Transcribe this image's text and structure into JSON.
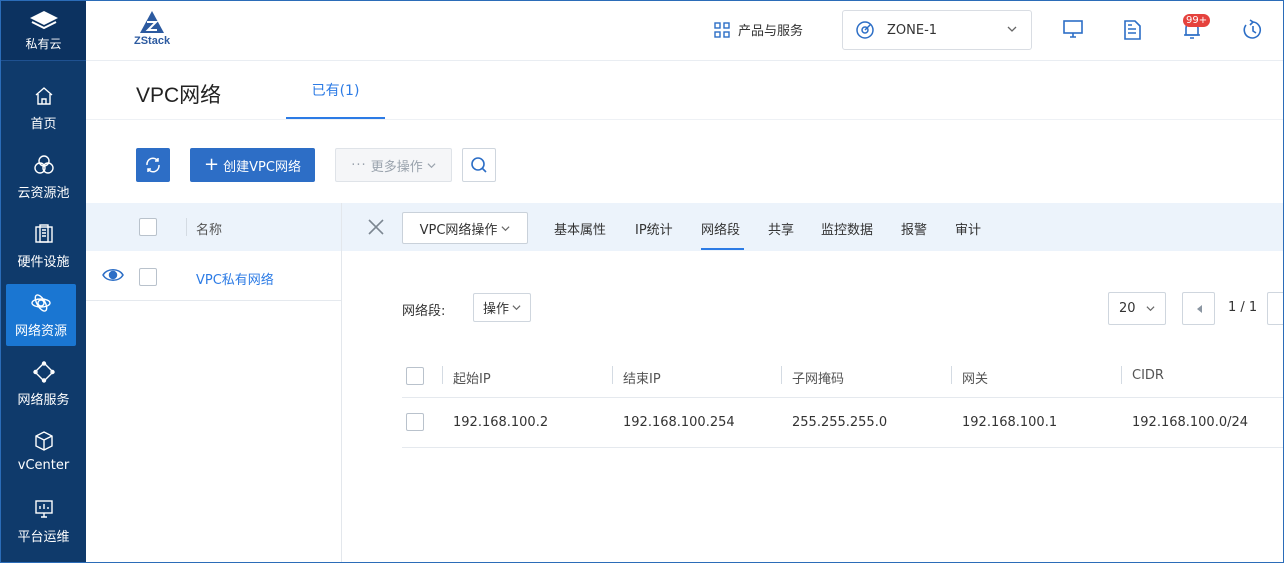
{
  "sidebar": {
    "brand_label": "私有云",
    "items": [
      {
        "label": "首页",
        "icon": "home-icon"
      },
      {
        "label": "云资源池",
        "icon": "cloud-pool-icon"
      },
      {
        "label": "硬件设施",
        "icon": "hardware-icon"
      },
      {
        "label": "网络资源",
        "icon": "network-icon",
        "active": true
      },
      {
        "label": "网络服务",
        "icon": "network-service-icon"
      },
      {
        "label": "vCenter",
        "icon": "cube-icon"
      },
      {
        "label": "平台运维",
        "icon": "platform-ops-icon"
      }
    ]
  },
  "header": {
    "logo_text": "ZStack",
    "products_label": "产品与服务",
    "zone_label": "ZONE-1",
    "notification_badge": "99+"
  },
  "page": {
    "title": "VPC网络",
    "tab_existing": "已有(1)"
  },
  "toolbar": {
    "create_label": "创建VPC网络",
    "more_label": "更多操作"
  },
  "list": {
    "column_name": "名称",
    "rows": [
      {
        "name": "VPC私有网络"
      }
    ]
  },
  "detail": {
    "ops_label": "VPC网络操作",
    "tabs": [
      "基本属性",
      "IP统计",
      "网络段",
      "共享",
      "监控数据",
      "报警",
      "审计"
    ],
    "active_tab": "网络段"
  },
  "segment": {
    "label": "网络段:",
    "op_label": "操作",
    "page_size": "20",
    "page_indicator": "1 / 1"
  },
  "table": {
    "columns": [
      "起始IP",
      "结束IP",
      "子网掩码",
      "网关",
      "CIDR"
    ],
    "rows": [
      [
        "192.168.100.2",
        "192.168.100.254",
        "255.255.255.0",
        "192.168.100.1",
        "192.168.100.0/24"
      ]
    ]
  },
  "colors": {
    "sidebar_bg": "#0f3a6b",
    "sidebar_active": "#1a76d2",
    "primary": "#2d6ec6",
    "link": "#2c7be5",
    "badge": "#e5423d"
  }
}
